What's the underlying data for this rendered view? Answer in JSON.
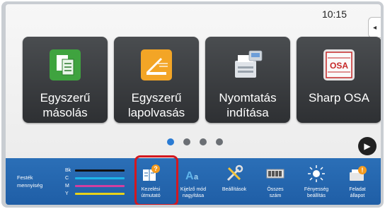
{
  "status": {
    "time": "10:15"
  },
  "side_tab": {
    "glyph": "◂"
  },
  "tiles": [
    {
      "label_line1": "Egyszerű",
      "label_line2": "másolás",
      "icon": "copy-icon"
    },
    {
      "label_line1": "Egyszerű",
      "label_line2": "lapolvasás",
      "icon": "scan-icon"
    },
    {
      "label_line1": "Nyomtatás",
      "label_line2": "indítása",
      "icon": "printer-icon"
    },
    {
      "label_line1": "Sharp OSA",
      "label_line2": "",
      "icon": "osa-icon",
      "logo_text": "OSA"
    }
  ],
  "pager": {
    "pages": 4,
    "active": 0,
    "next_glyph": "▶"
  },
  "toner": {
    "title": "Festék mennyiség",
    "channels": [
      {
        "name": "Bk",
        "color": "#111111"
      },
      {
        "name": "C",
        "color": "#1fb3e6"
      },
      {
        "name": "M",
        "color": "#d23fa0"
      },
      {
        "name": "Y",
        "color": "#e7d21a"
      }
    ]
  },
  "bottom_icons": [
    {
      "label_line1": "Kezelési",
      "label_line2": "útmutató",
      "icon": "manual-icon",
      "highlighted": true
    },
    {
      "label_line1": "Kijelző mód",
      "label_line2": "nagyítása",
      "icon": "display-zoom-icon"
    },
    {
      "label_line1": "Beállítások",
      "label_line2": "",
      "icon": "settings-tools-icon"
    },
    {
      "label_line1": "Összes",
      "label_line2": "szám",
      "icon": "counter-icon"
    },
    {
      "label_line1": "Fényesség",
      "label_line2": "beállítás",
      "icon": "brightness-icon"
    },
    {
      "label_line1": "Feladat",
      "label_line2": "állapot",
      "icon": "job-status-icon"
    }
  ],
  "colors": {
    "accent": "#2a7bd3",
    "bar": "#2264ab",
    "highlight": "#d3181f"
  }
}
